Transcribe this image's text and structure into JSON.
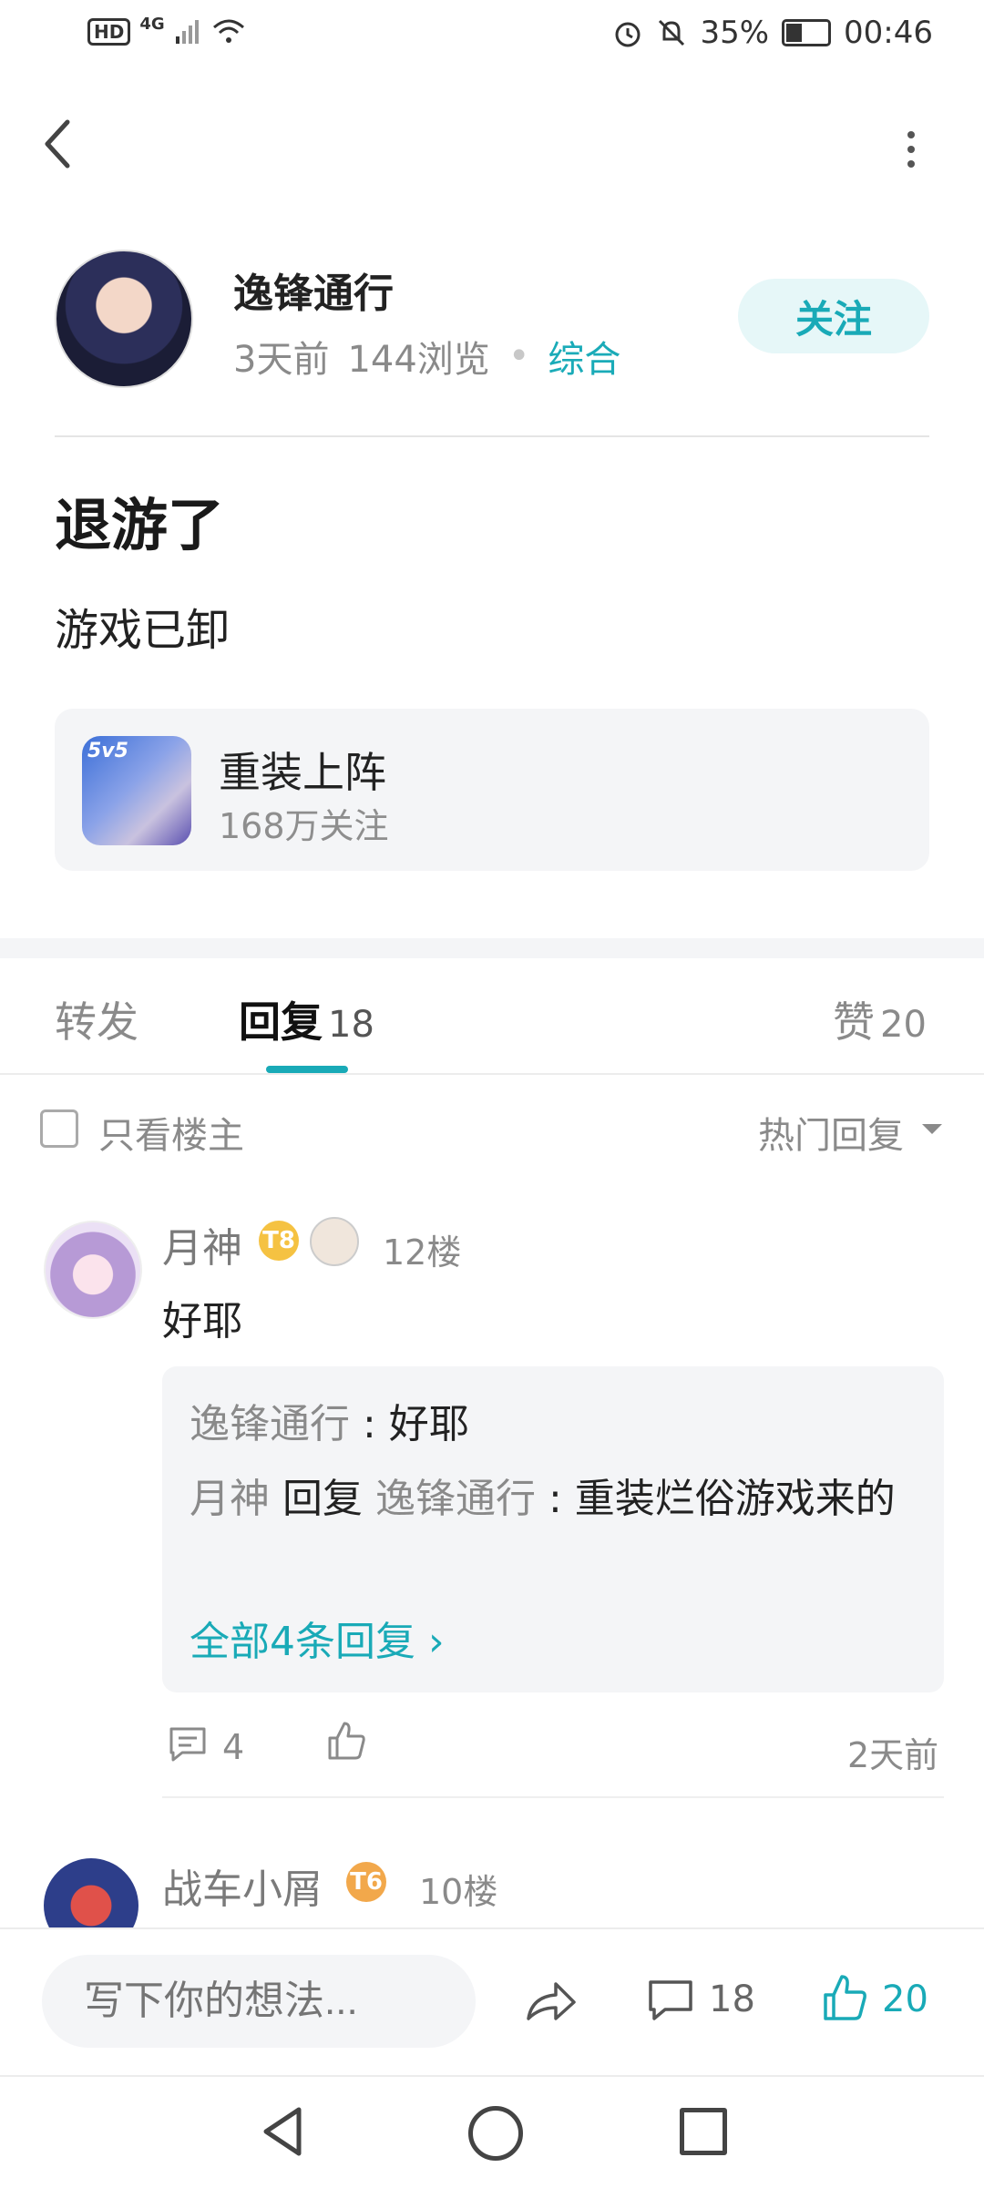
{
  "status_bar": {
    "network": "4G",
    "hd": "HD",
    "battery": "35%",
    "time": "00:46"
  },
  "post": {
    "author": "逸锋通行",
    "time": "3天前",
    "views": "144浏览",
    "category": "综合",
    "follow_label": "关注",
    "title": "退游了",
    "body": "游戏已卸"
  },
  "game": {
    "name": "重装上阵",
    "followers": "168万关注",
    "icon_text": "5v5"
  },
  "tabs": {
    "forward": "转发",
    "reply": "回复",
    "reply_count": "18",
    "like": "赞",
    "like_count": "20"
  },
  "filter": {
    "only_op": "只看楼主",
    "sort": "热门回复"
  },
  "comments": [
    {
      "user": "月神",
      "badge": "T8",
      "floor": "12楼",
      "text": "好耶",
      "replies": [
        {
          "user": "逸锋通行",
          "sep": " : ",
          "text": "好耶"
        },
        {
          "user": "月神",
          "action": " 回复 ",
          "target": "逸锋通行",
          "sep": " : ",
          "text": "重装烂俗游戏来的"
        }
      ],
      "more_replies": "全部4条回复 ›",
      "reply_count": "4",
      "time": "2天前"
    },
    {
      "user": "战车小屑",
      "badge": "T6",
      "floor": "10楼"
    }
  ],
  "bottom_bar": {
    "input_placeholder": "写下你的想法...",
    "comment_count": "18",
    "like_count": "20"
  },
  "accent_color": "#19aab7"
}
